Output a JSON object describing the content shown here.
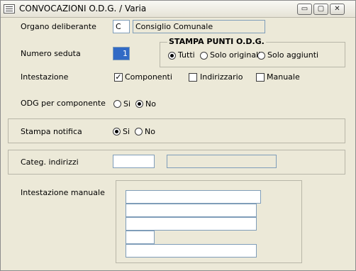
{
  "window": {
    "title": "CONVOCAZIONI O.D.G. / Varia",
    "controls": {
      "minimize": "▭",
      "maximize": "▢",
      "close": "✕"
    }
  },
  "organo": {
    "label": "Organo deliberante",
    "code": "C",
    "description": "Consiglio Comunale"
  },
  "seduta": {
    "label": "Numero seduta",
    "value": "1"
  },
  "stampa_punti": {
    "title": "STAMPA PUNTI O.D.G.",
    "options": [
      "Tutti",
      "Solo originali",
      "Solo aggiunti"
    ],
    "selected": "Tutti"
  },
  "intestazione": {
    "label": "Intestazione",
    "options": [
      {
        "label": "Componenti",
        "checked": true
      },
      {
        "label": "Indirizzario",
        "checked": false
      },
      {
        "label": "Manuale",
        "checked": false
      }
    ]
  },
  "odg_componente": {
    "label": "ODG per componente",
    "options": [
      "Si",
      "No"
    ],
    "selected": "No"
  },
  "stampa_notifica": {
    "label": "Stampa notifica",
    "options": [
      "Si",
      "No"
    ],
    "selected": "Si"
  },
  "categ_indirizzi": {
    "label": "Categ. indirizzi",
    "code": "",
    "description": ""
  },
  "intestazione_manuale": {
    "label": "Intestazione manuale",
    "lines": [
      "",
      "",
      "",
      "",
      ""
    ]
  },
  "icons": {
    "window": "form-icon",
    "check_mark": "✓"
  }
}
